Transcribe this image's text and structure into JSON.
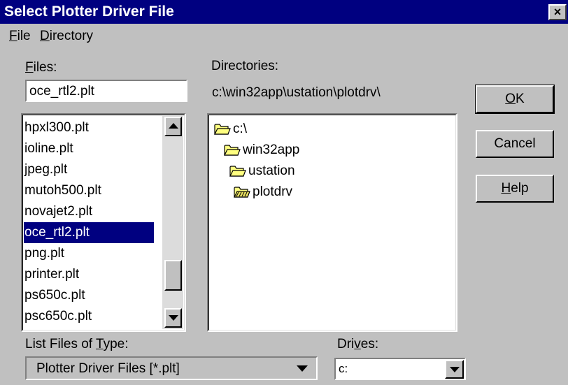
{
  "window": {
    "title": "Select Plotter Driver File",
    "close_label": "×"
  },
  "menu": [
    {
      "label": "File",
      "accel": "F",
      "rest": "ile"
    },
    {
      "label": "Directory",
      "accel": "D",
      "rest": "irectory"
    }
  ],
  "files": {
    "label_accel": "F",
    "label_rest": "iles:",
    "input_value": "oce_rtl2.plt",
    "items": [
      "hpxl300.plt",
      "ioline.plt",
      "jpeg.plt",
      "mutoh500.plt",
      "novajet2.plt",
      "oce_rtl2.plt",
      "png.plt",
      "printer.plt",
      "ps650c.plt",
      "psc650c.plt"
    ],
    "selected": "oce_rtl2.plt"
  },
  "directories": {
    "label": "Directories:",
    "path": "c:\\win32app\\ustation\\plotdrv\\",
    "tree": [
      {
        "name": "c:\\",
        "icon": "open-folder-icon"
      },
      {
        "name": "win32app",
        "icon": "open-folder-icon"
      },
      {
        "name": "ustation",
        "icon": "open-folder-icon"
      },
      {
        "name": "plotdrv",
        "icon": "current-folder-icon"
      }
    ]
  },
  "buttons": {
    "ok": {
      "accel": "O",
      "rest": "K"
    },
    "cancel": {
      "label": "Cancel"
    },
    "help": {
      "accel": "H",
      "rest": "elp"
    }
  },
  "file_type": {
    "label_pre": "List Files of ",
    "label_accel": "T",
    "label_post": "ype:",
    "value": "Plotter Driver Files [*.plt]"
  },
  "drives": {
    "label_pre": "Dri",
    "label_accel": "v",
    "label_post": "es:",
    "value": "c:"
  },
  "colors": {
    "titlebar": "#000080",
    "face": "#c0c0c0",
    "selection": "#000080",
    "folder": "#ffff80"
  }
}
